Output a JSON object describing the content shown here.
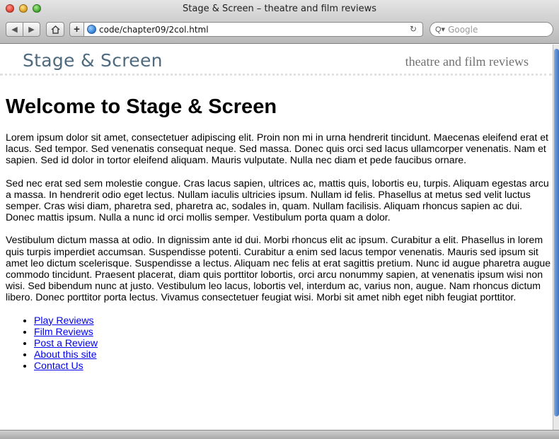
{
  "window": {
    "title": "Stage & Screen – theatre and film reviews"
  },
  "toolbar": {
    "url": "code/chapter09/2col.html",
    "search_placeholder": "Google",
    "add_label": "+"
  },
  "site": {
    "title": "Stage & Screen",
    "tagline": "theatre and film reviews"
  },
  "main": {
    "heading": "Welcome to Stage & Screen",
    "paragraphs": [
      "Lorem ipsum dolor sit amet, consectetuer adipiscing elit. Proin non mi in urna hendrerit tincidunt. Maecenas eleifend erat et lacus. Sed tempor. Sed venenatis consequat neque. Sed massa. Donec quis orci sed lacus ullamcorper venenatis. Nam et sapien. Sed id dolor in tortor eleifend aliquam. Mauris vulputate. Nulla nec diam et pede faucibus ornare.",
      "Sed nec erat sed sem molestie congue. Cras lacus sapien, ultrices ac, mattis quis, lobortis eu, turpis. Aliquam egestas arcu a massa. In hendrerit odio eget lectus. Nullam iaculis ultricies ipsum. Nullam id felis. Phasellus at metus sed velit luctus semper. Cras wisi diam, pharetra sed, pharetra ac, sodales in, quam. Nullam facilisis. Aliquam rhoncus sapien ac dui. Donec mattis ipsum. Nulla a nunc id orci mollis semper. Vestibulum porta quam a dolor.",
      "Vestibulum dictum massa at odio. In dignissim ante id dui. Morbi rhoncus elit ac ipsum. Curabitur a elit. Phasellus in lorem quis turpis imperdiet accumsan. Suspendisse potenti. Curabitur a enim sed lacus tempor venenatis. Mauris sed ipsum sit amet leo dictum scelerisque. Suspendisse a lectus. Aliquam nec felis at erat sagittis pretium. Nunc id augue pharetra augue commodo tincidunt. Praesent placerat, diam quis porttitor lobortis, orci arcu nonummy sapien, at venenatis ipsum wisi non wisi. Sed bibendum nunc at justo. Vestibulum leo lacus, lobortis vel, interdum ac, varius non, augue. Nam rhoncus dictum libero. Donec porttitor porta lectus. Vivamus consectetuer feugiat wisi. Morbi sit amet nibh eget nibh feugiat porttitor."
    ],
    "nav_links": [
      "Play Reviews",
      "Film Reviews",
      "Post a Review",
      "About this site",
      "Contact Us"
    ]
  }
}
